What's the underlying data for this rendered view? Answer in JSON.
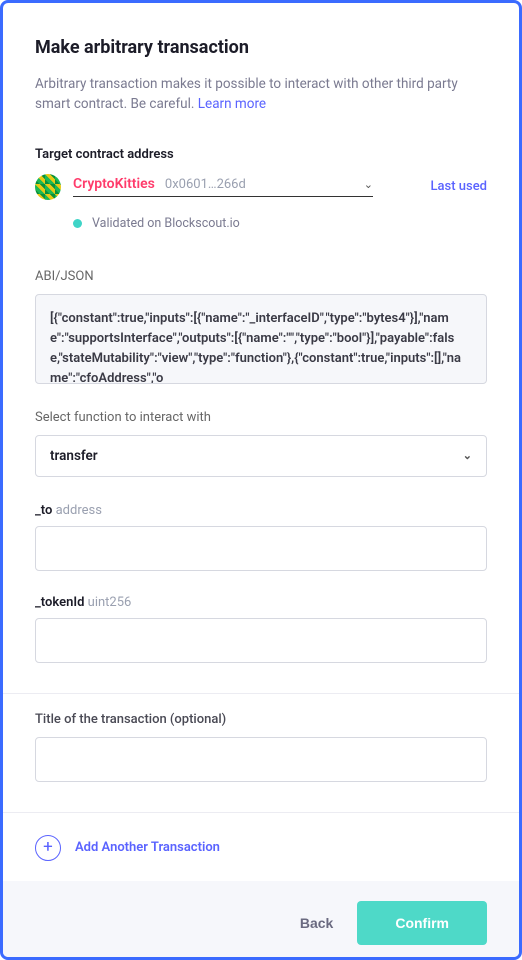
{
  "header": {
    "title": "Make arbitrary transaction",
    "description": "Arbitrary transaction makes it possible to interact with other third party smart contract. Be careful. ",
    "learn_more": "Learn more"
  },
  "contract": {
    "label": "Target contract address",
    "name": "CryptoKitties",
    "address": "0x0601…266d",
    "last_used": "Last used",
    "validated": "Validated on Blockscout.io"
  },
  "abi": {
    "label": "ABI/JSON",
    "value": "[{\"constant\":true,\"inputs\":[{\"name\":\"_interfaceID\",\"type\":\"bytes4\"}],\"name\":\"supportsInterface\",\"outputs\":[{\"name\":\"\",\"type\":\"bool\"}],\"payable\":false,\"stateMutability\":\"view\",\"type\":\"function\"},{\"constant\":true,\"inputs\":[],\"name\":\"cfoAddress\",\"o"
  },
  "function_select": {
    "label": "Select function to interact with",
    "value": "transfer"
  },
  "params": [
    {
      "name": "_to",
      "type": "address"
    },
    {
      "name": "_tokenId",
      "type": "uint256"
    }
  ],
  "title_field": {
    "label": "Title of the transaction (optional)"
  },
  "add_another": "Add Another Transaction",
  "footer": {
    "back": "Back",
    "confirm": "Confirm"
  }
}
